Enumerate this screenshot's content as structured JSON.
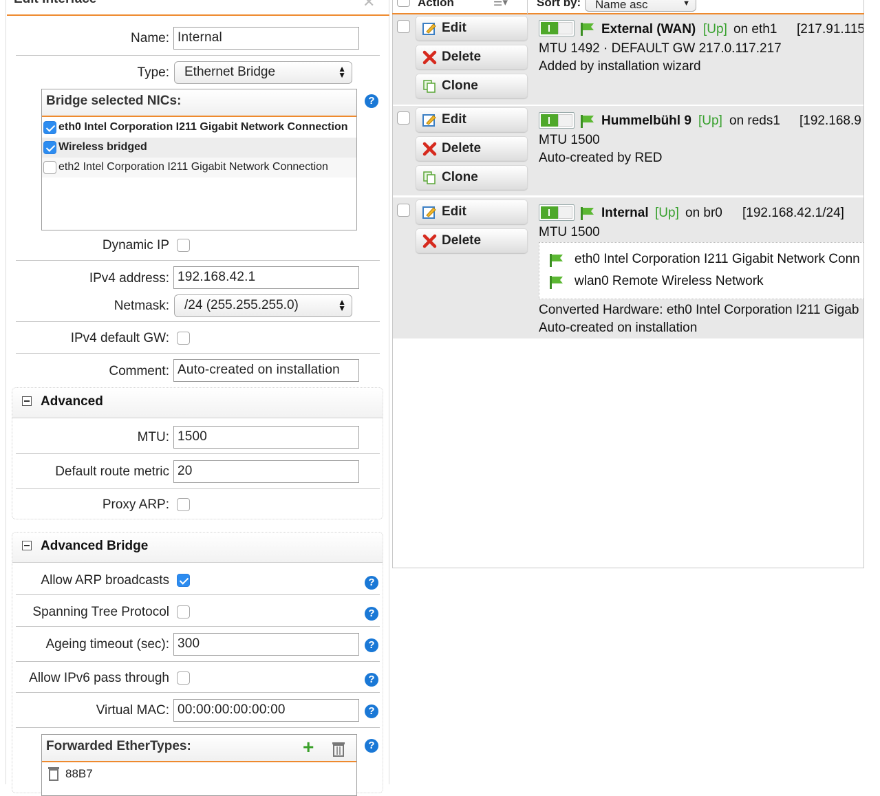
{
  "dialog": {
    "title": "Edit Interface",
    "name_label": "Name:",
    "name_value": "Internal",
    "type_label": "Type:",
    "type_value": "Ethernet Bridge",
    "nics_title": "Bridge selected NICs:",
    "nics": [
      {
        "label": "eth0 Intel Corporation I211 Gigabit Network Connection",
        "checked": true
      },
      {
        "label": "Wireless bridged",
        "checked": true
      },
      {
        "label": "eth2 Intel Corporation I211 Gigabit Network Connection",
        "checked": false
      }
    ],
    "dynamic_ip_label": "Dynamic IP",
    "ipv4_label": "IPv4 address:",
    "ipv4_value": "192.168.42.1",
    "netmask_label": "Netmask:",
    "netmask_value": "/24 (255.255.255.0)",
    "default_gw_label": "IPv4 default GW:",
    "comment_label": "Comment:",
    "comment_value": "Auto-created on installation",
    "advanced": {
      "title": "Advanced",
      "mtu_label": "MTU:",
      "mtu_value": "1500",
      "metric_label": "Default route metric",
      "metric_value": "20",
      "proxy_arp_label": "Proxy ARP:"
    },
    "advanced_bridge": {
      "title": "Advanced Bridge",
      "arp_label": "Allow ARP broadcasts",
      "stp_label": "Spanning Tree Protocol",
      "ageing_label": "Ageing timeout (sec):",
      "ageing_value": "300",
      "ipv6_label": "Allow IPv6 pass through",
      "mac_label": "Virtual MAC:",
      "mac_value": "00:00:00:00:00:00",
      "ethertypes_title": "Forwarded EtherTypes:",
      "ethertypes": [
        "88B7"
      ]
    }
  },
  "list": {
    "action_header": "Action",
    "sort_label": "Sort by:",
    "sort_value": "Name asc",
    "buttons": {
      "edit": "Edit",
      "delete": "Delete",
      "clone": "Clone"
    },
    "entries": [
      {
        "name": "External (WAN)",
        "status": "[Up]",
        "on": "on eth1",
        "addr": "[217.91.115",
        "line1": "MTU 1492 · DEFAULT GW 217.0.117.217",
        "line2": "Added by installation wizard"
      },
      {
        "name": "Hummelbühl 9",
        "status": "[Up]",
        "on": "on reds1",
        "addr": "[192.168.9",
        "line1": "MTU 1500",
        "line2": "Auto-created by RED"
      },
      {
        "name": "Internal",
        "status": "[Up]",
        "on": "on br0",
        "addr": "[192.168.42.1/24]",
        "line1": "MTU 1500",
        "members": [
          "eth0 Intel Corporation I211 Gigabit Network Conn",
          "wlan0 Remote Wireless Network"
        ],
        "line2": "Converted Hardware: eth0 Intel Corporation I211 Gigab",
        "line3": "Auto-created on installation"
      }
    ]
  },
  "colors": {
    "accent": "#ee8a2e",
    "up": "#36a02c",
    "help": "#1a78d6",
    "checked": "#2c8cf0"
  }
}
